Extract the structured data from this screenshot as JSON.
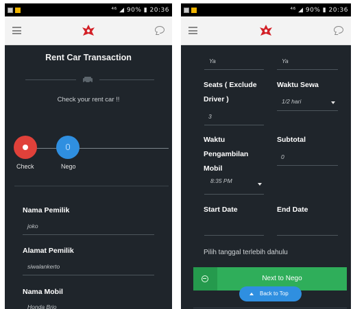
{
  "status_bar": {
    "right_text": "⁴⁶ ◢ 90% ▮ 20:36"
  },
  "left_screen": {
    "title": "Rent Car Transaction",
    "subtitle": "Check your rent car !!",
    "steps": [
      {
        "label": "Check",
        "color": "#e0413a"
      },
      {
        "label": "Nego",
        "color": "#2f8fe0"
      }
    ],
    "fields": [
      {
        "label": "Nama Pemilik",
        "value": "joko"
      },
      {
        "label": "Alamat Pemilik",
        "value": "siwalankerto"
      },
      {
        "label": "Nama Mobil",
        "value": "Honda Brio"
      }
    ]
  },
  "right_screen": {
    "top_values": {
      "left": "Ya",
      "right": "Ya"
    },
    "seats": {
      "label_line1": "Seats ( Exclude",
      "label_line2": "Driver )",
      "value": "3"
    },
    "waktu_sewa": {
      "label": "Waktu Sewa",
      "value": "1/2 hari"
    },
    "waktu_pengambilan": {
      "label_line1": "Waktu",
      "label_line2": "Pengambilan",
      "label_line3": "Mobil",
      "value": "8:35 PM"
    },
    "subtotal": {
      "label": "Subtotal",
      "value": "0"
    },
    "start_date": {
      "label": "Start Date"
    },
    "end_date": {
      "label": "End Date"
    },
    "hint": "Pilih tanggal terlebih dahulu",
    "next_button": "Next to Nego",
    "back_to_top": "Back to Top"
  },
  "colors": {
    "background": "#1f252b",
    "accent_green": "#2fae5a",
    "accent_blue": "#2f8fe0",
    "accent_red": "#e0413a",
    "logo_red": "#d32027"
  }
}
